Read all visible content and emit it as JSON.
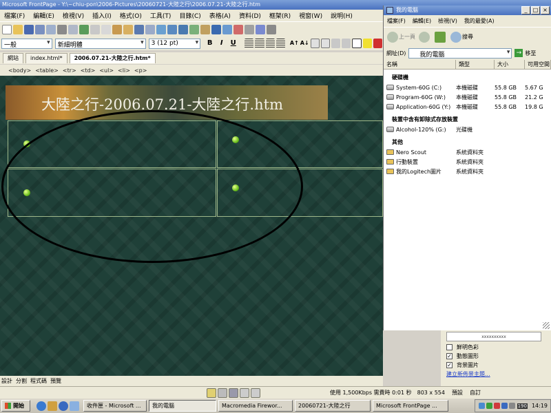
{
  "app": {
    "title": "Microsoft FrontPage - Y:\\~chiu-pon\\2006-Pictures\\20060721-大陸之行\\2006.07.21-大陸之行.htm"
  },
  "menu": [
    "檔案(F)",
    "編輯(E)",
    "檢視(V)",
    "插入(I)",
    "格式(O)",
    "工具(T)",
    "目錄(C)",
    "表格(A)",
    "資料(D)",
    "框架(R)",
    "視窗(W)",
    "說明(H)"
  ],
  "format": {
    "style": "一般",
    "font": "新細明體",
    "size": "3  (12 pt)",
    "bold": "B",
    "italic": "I",
    "underline": "U",
    "grow_font": "A↑",
    "shrink_font": "A↓"
  },
  "doc_tabs": [
    "網站",
    "index.html*",
    "2006.07.21-大陸之行.htm*"
  ],
  "tags": [
    "<body>",
    "<table>",
    "<tr>",
    "<td>",
    "<ul>",
    "<li>",
    "<p>"
  ],
  "page": {
    "banner_title": "大陸之行-2006.07.21-大陸之行.htm"
  },
  "view_tabs": [
    "設計",
    "分割",
    "程式碼",
    "預覽"
  ],
  "status": {
    "speed": "使用 1,500Kbps 需費時 0:01 秒",
    "resolution": "803 x 554",
    "preset": "預設",
    "custom": "自訂"
  },
  "explorer": {
    "title": "我的電腦",
    "menu": [
      "檔案(F)",
      "編輯(E)",
      "檢視(V)",
      "我的最愛(A)"
    ],
    "back": "上一頁",
    "search": "搜尋",
    "address_label": "網址(D)",
    "address_value": "我的電腦",
    "go": "移至",
    "columns": [
      "名稱",
      "類型",
      "大小",
      "可用空間"
    ],
    "groups": [
      {
        "name": "硬碟機",
        "items": [
          {
            "name": "System-60G (C:)",
            "type": "本機磁碟",
            "size": "55.8 GB",
            "free": "5.67 G"
          },
          {
            "name": "Program-60G (W:)",
            "type": "本機磁碟",
            "size": "55.8 GB",
            "free": "21.2 G"
          },
          {
            "name": "Application-60G (Y:)",
            "type": "本機磁碟",
            "size": "55.8 GB",
            "free": "19.8 G"
          }
        ]
      },
      {
        "name": "裝置中含有卸除式存放裝置",
        "items": [
          {
            "name": "Alcohol-120% (G:)",
            "type": "光碟機",
            "size": "",
            "free": ""
          }
        ]
      },
      {
        "name": "其他",
        "items": [
          {
            "name": "Nero Scout",
            "type": "系統資料夾",
            "size": "",
            "free": ""
          },
          {
            "name": "行動裝置",
            "type": "系統資料夾",
            "size": "",
            "free": ""
          },
          {
            "name": "我的Logitech圖片",
            "type": "系統資料夾",
            "size": "",
            "free": ""
          }
        ]
      }
    ]
  },
  "task_pane": {
    "preview_text": "xxxxxxxxxx",
    "options": [
      {
        "label": "鮮明色彩",
        "checked": false
      },
      {
        "label": "動態圖形",
        "checked": true
      },
      {
        "label": "背景圖片",
        "checked": true
      }
    ],
    "link": "建立新佈景主題..."
  },
  "taskbar": {
    "start": "開始",
    "tasks": [
      "收件匣 - Microsoft ...",
      "我的電腦",
      "Macromedia Firewor...",
      "20060721-大陸之行",
      "Microsoft FrontPage ..."
    ],
    "clock": "14:19",
    "tray_badge": "190"
  }
}
